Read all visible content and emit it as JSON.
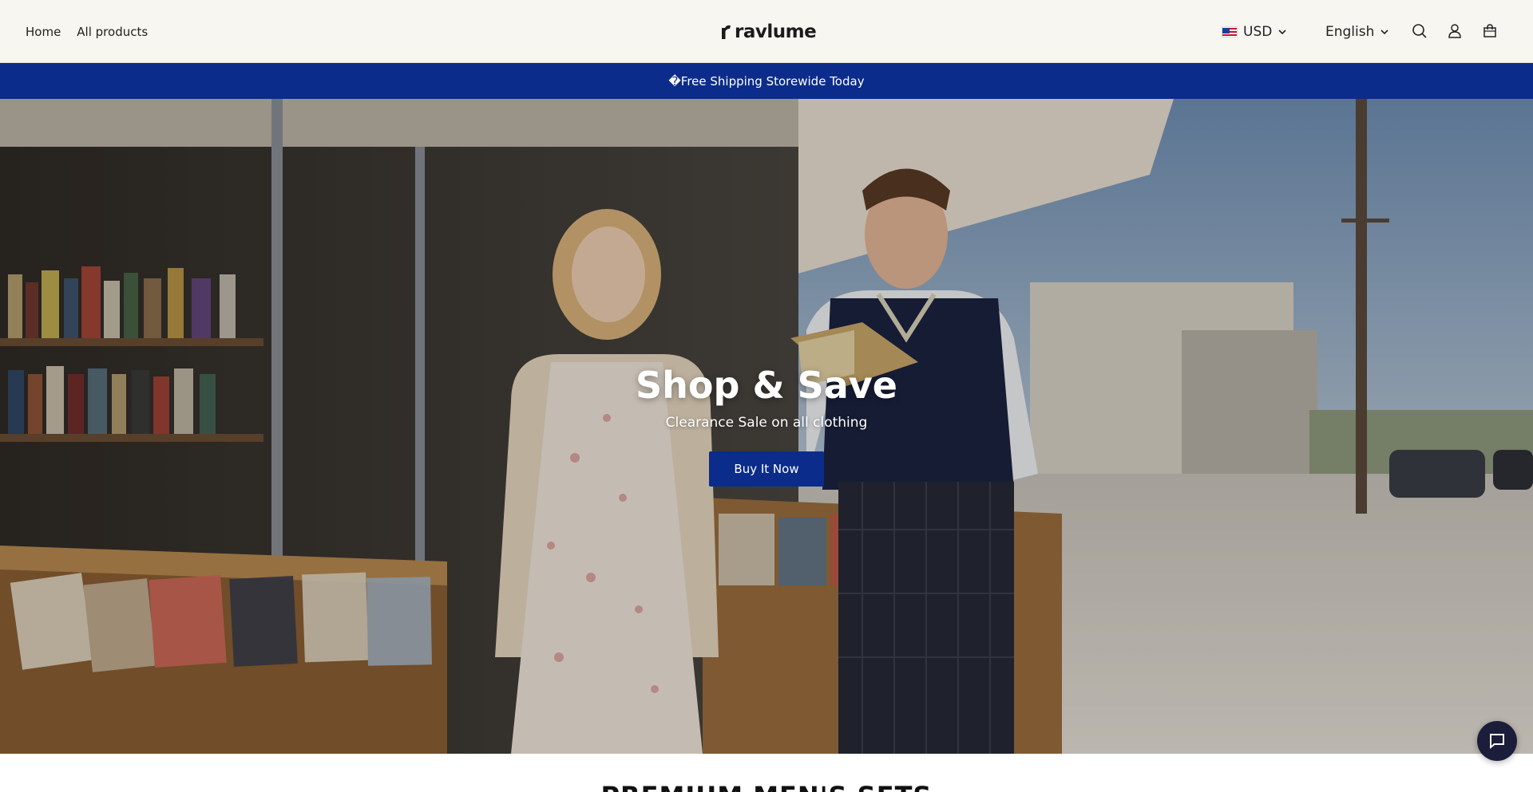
{
  "nav": {
    "links": [
      "Home",
      "All products"
    ]
  },
  "brand": {
    "name": "ravlume"
  },
  "locale": {
    "currency": "USD",
    "language": "English"
  },
  "icons": {
    "search": "search-icon",
    "account": "account-icon",
    "cart": "cart-icon",
    "chat": "chat-icon"
  },
  "announcement": {
    "text": "�Free Shipping Storewide Today"
  },
  "hero": {
    "title": "Shop & Save",
    "subtitle": "Clearance Sale on all clothing",
    "button_label": "Buy It Now"
  },
  "next_section": {
    "title": "PREMIUM MEN'S SETS"
  },
  "colors": {
    "accent": "#0b2c8a",
    "header_bg": "#f8f6f1",
    "chat_bg": "#1b1d3a"
  }
}
